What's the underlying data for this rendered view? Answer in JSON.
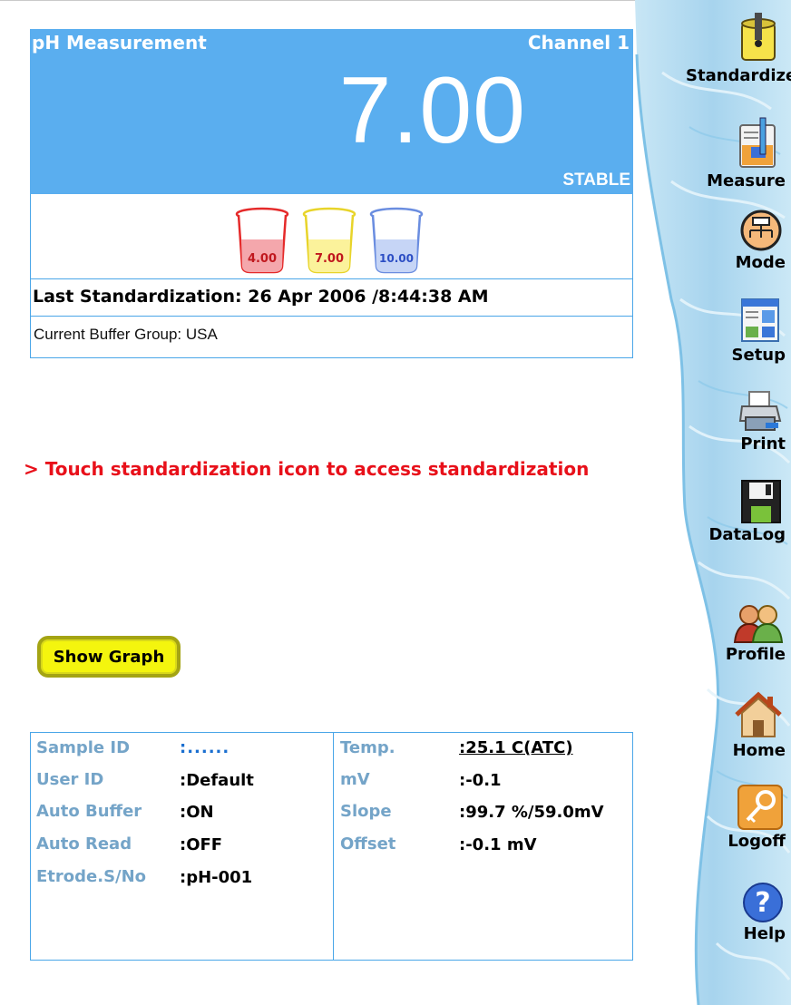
{
  "measurement": {
    "title": "pH Measurement",
    "channel": "Channel 1",
    "reading": "7.00",
    "status": "STABLE"
  },
  "buffers": [
    "4.00",
    "7.00",
    "10.00"
  ],
  "last_standardization": "Last Standardization: 26 Apr 2006 /8:44:38 AM",
  "buffer_group": "Current Buffer Group: USA",
  "message": "> Touch standardization icon to access standardization",
  "show_graph_label": "Show Graph",
  "details": {
    "left": [
      {
        "label": "Sample ID",
        "value": ":......"
      },
      {
        "label": "User ID",
        "value": ":Default"
      },
      {
        "label": "Auto Buffer",
        "value": ":ON"
      },
      {
        "label": "Auto Read",
        "value": ":OFF"
      },
      {
        "label": "Etrode.S/No",
        "value": ":pH-001"
      }
    ],
    "right": [
      {
        "label": "Temp.",
        "value": ":25.1 C(ATC)"
      },
      {
        "label": "mV",
        "value": ":-0.1"
      },
      {
        "label": "Slope",
        "value": ":99.7 %/59.0mV"
      },
      {
        "label": "Offset",
        "value": ":-0.1 mV"
      }
    ]
  },
  "toolbar": {
    "standardize": "Standardize",
    "measure": "Measure",
    "mode": "Mode",
    "setup": "Setup",
    "print": "Print",
    "datalog": "DataLog",
    "profile": "Profile",
    "home": "Home",
    "logoff": "Logoff",
    "help": "Help"
  },
  "colors": {
    "panel": "#5aaeef",
    "border": "#4aa6e8",
    "message": "#e8101a",
    "button": "#f4f50e",
    "label": "#74a4c8"
  }
}
